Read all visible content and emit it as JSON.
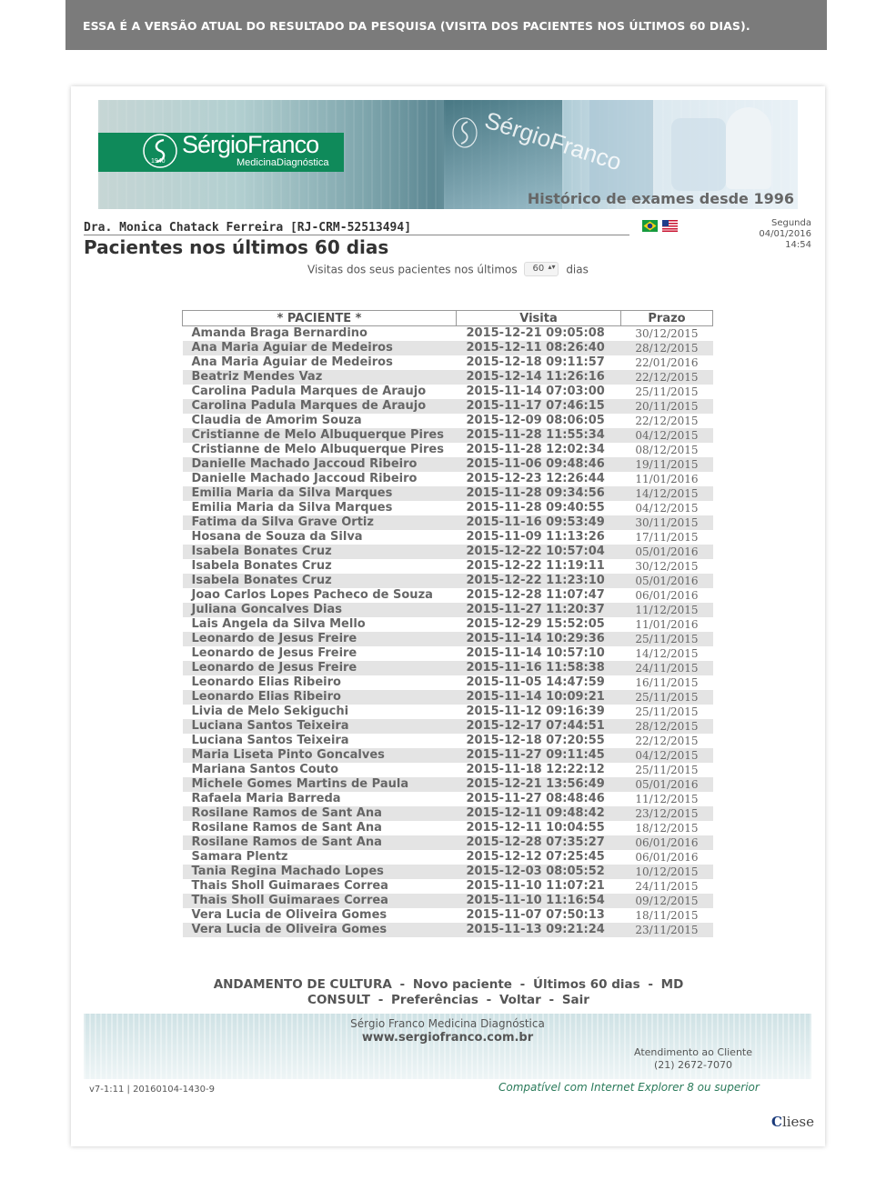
{
  "notice": "ESSA É A VERSÃO ATUAL DO RESULTADO DA PESQUISA (VISITA DOS PACIENTES NOS ÚLTIMOS 60 DIAS).",
  "banner": {
    "logo_year": "1940",
    "brand": "SérgioFranco",
    "brand_sub": "MedicinaDiagnóstica",
    "tagline": "Histórico de exames desde 1996"
  },
  "doctor": "Dra. Monica Chatack Ferreira [RJ-CRM-52513494]",
  "date": {
    "weekday": "Segunda",
    "date": "04/01/2016",
    "time": "14:54"
  },
  "page_title": "Pacientes nos últimos 60 dias",
  "filter": {
    "label": "Visitas dos seus pacientes nos últimos",
    "value": "60",
    "suffix": "dias"
  },
  "table": {
    "headers": [
      "* PACIENTE *",
      "Visita",
      "Prazo"
    ],
    "rows": [
      [
        "Amanda Braga Bernardino",
        "2015-12-21 09:05:08",
        "30/12/2015"
      ],
      [
        "Ana Maria Aguiar de Medeiros",
        "2015-12-11 08:26:40",
        "28/12/2015"
      ],
      [
        "Ana Maria Aguiar de Medeiros",
        "2015-12-18 09:11:57",
        "22/01/2016"
      ],
      [
        "Beatriz Mendes Vaz",
        "2015-12-14 11:26:16",
        "22/12/2015"
      ],
      [
        "Carolina Padula Marques de Araujo",
        "2015-11-14 07:03:00",
        "25/11/2015"
      ],
      [
        "Carolina Padula Marques de Araujo",
        "2015-11-17 07:46:15",
        "20/11/2015"
      ],
      [
        "Claudia de Amorim Souza",
        "2015-12-09 08:06:05",
        "22/12/2015"
      ],
      [
        "Cristianne de Melo Albuquerque Pires",
        "2015-11-28 11:55:34",
        "04/12/2015"
      ],
      [
        "Cristianne de Melo Albuquerque Pires",
        "2015-11-28 12:02:34",
        "08/12/2015"
      ],
      [
        "Danielle Machado Jaccoud Ribeiro",
        "2015-11-06 09:48:46",
        "19/11/2015"
      ],
      [
        "Danielle Machado Jaccoud Ribeiro",
        "2015-12-23 12:26:44",
        "11/01/2016"
      ],
      [
        "Emilia Maria da Silva Marques",
        "2015-11-28 09:34:56",
        "14/12/2015"
      ],
      [
        "Emilia Maria da Silva Marques",
        "2015-11-28 09:40:55",
        "04/12/2015"
      ],
      [
        "Fatima da Silva Grave Ortiz",
        "2015-11-16 09:53:49",
        "30/11/2015"
      ],
      [
        "Hosana de Souza da Silva",
        "2015-11-09 11:13:26",
        "17/11/2015"
      ],
      [
        "Isabela Bonates Cruz",
        "2015-12-22 10:57:04",
        "05/01/2016"
      ],
      [
        "Isabela Bonates Cruz",
        "2015-12-22 11:19:11",
        "30/12/2015"
      ],
      [
        "Isabela Bonates Cruz",
        "2015-12-22 11:23:10",
        "05/01/2016"
      ],
      [
        "Joao Carlos Lopes Pacheco de Souza",
        "2015-12-28 11:07:47",
        "06/01/2016"
      ],
      [
        "Juliana Goncalves Dias",
        "2015-11-27 11:20:37",
        "11/12/2015"
      ],
      [
        "Lais Angela da Silva Mello",
        "2015-12-29 15:52:05",
        "11/01/2016"
      ],
      [
        "Leonardo de Jesus Freire",
        "2015-11-14 10:29:36",
        "25/11/2015"
      ],
      [
        "Leonardo de Jesus Freire",
        "2015-11-14 10:57:10",
        "14/12/2015"
      ],
      [
        "Leonardo de Jesus Freire",
        "2015-11-16 11:58:38",
        "24/11/2015"
      ],
      [
        "Leonardo Elias Ribeiro",
        "2015-11-05 14:47:59",
        "16/11/2015"
      ],
      [
        "Leonardo Elias Ribeiro",
        "2015-11-14 10:09:21",
        "25/11/2015"
      ],
      [
        "Livia de Melo Sekiguchi",
        "2015-11-12 09:16:39",
        "25/11/2015"
      ],
      [
        "Luciana Santos Teixeira",
        "2015-12-17 07:44:51",
        "28/12/2015"
      ],
      [
        "Luciana Santos Teixeira",
        "2015-12-18 07:20:55",
        "22/12/2015"
      ],
      [
        "Maria Liseta Pinto Goncalves",
        "2015-11-27 09:11:45",
        "04/12/2015"
      ],
      [
        "Mariana Santos Couto",
        "2015-11-18 12:22:12",
        "25/11/2015"
      ],
      [
        "Michele Gomes Martins de Paula",
        "2015-12-21 13:56:49",
        "05/01/2016"
      ],
      [
        "Rafaela Maria Barreda",
        "2015-11-27 08:48:46",
        "11/12/2015"
      ],
      [
        "Rosilane Ramos de Sant Ana",
        "2015-12-11 09:48:42",
        "23/12/2015"
      ],
      [
        "Rosilane Ramos de Sant Ana",
        "2015-12-11 10:04:55",
        "18/12/2015"
      ],
      [
        "Rosilane Ramos de Sant Ana",
        "2015-12-28 07:35:27",
        "06/01/2016"
      ],
      [
        "Samara Plentz",
        "2015-12-12 07:25:45",
        "06/01/2016"
      ],
      [
        "Tania Regina Machado Lopes",
        "2015-12-03 08:05:52",
        "10/12/2015"
      ],
      [
        "Thais Sholl Guimaraes Correa",
        "2015-11-10 11:07:21",
        "24/11/2015"
      ],
      [
        "Thais Sholl Guimaraes Correa",
        "2015-11-10 11:16:54",
        "09/12/2015"
      ],
      [
        "Vera Lucia de Oliveira Gomes",
        "2015-11-07 07:50:13",
        "18/11/2015"
      ],
      [
        "Vera Lucia de Oliveira Gomes",
        "2015-11-13 09:21:24",
        "23/11/2015"
      ]
    ]
  },
  "footer_links": {
    "line1": [
      "ANDAMENTO DE CULTURA",
      "Novo paciente",
      "Últimos 60 dias",
      "MD"
    ],
    "line2": [
      "CONSULT",
      "Preferências",
      "Voltar",
      "Sair"
    ],
    "separator": "-"
  },
  "footer": {
    "company": "Sérgio Franco Medicina Diagnóstica",
    "website": "www.sergiofranco.com.br",
    "support_label": "Atendimento ao Cliente",
    "support_phone": "(21) 2672-7070",
    "version": "v7-1:11 | 20160104-1430-9",
    "compat": "Compatível com Internet Explorer 8 ou superior",
    "vendor_initial": "C",
    "vendor_rest": "liese"
  },
  "colors": {
    "brand_green": "#0f8a5a",
    "notice_bg": "#7b7b7b",
    "row_alt": "#e4e4e4"
  }
}
